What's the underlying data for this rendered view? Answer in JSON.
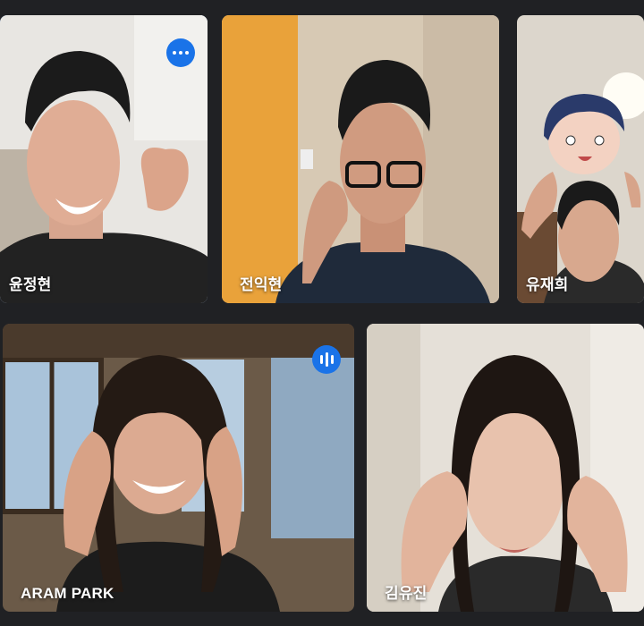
{
  "participants": [
    {
      "name": "윤정현",
      "active_speaker": true,
      "menu_icon": "more-options-icon"
    },
    {
      "name": "전익현"
    },
    {
      "name": "유재희"
    },
    {
      "name": "ARAM PARK",
      "audio_indicator": "audio-level-icon"
    },
    {
      "name": "김유진"
    }
  ],
  "colors": {
    "background": "#202124",
    "accent": "#1a73e8",
    "active_border": "#4a86e8"
  }
}
